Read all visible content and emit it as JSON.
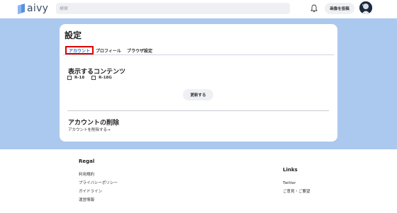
{
  "header": {
    "logo_text": "aivy",
    "search_placeholder": "検索",
    "post_button": "画像を投稿",
    "brand_color": "#5a8fe0"
  },
  "settings": {
    "title": "設定",
    "tabs": [
      {
        "label": "アカウント",
        "active": true
      },
      {
        "label": "プロフィール",
        "active": false
      },
      {
        "label": "ブラウザ設定",
        "active": false
      }
    ],
    "content_section": {
      "title": "表示するコンテンツ",
      "options": [
        {
          "label": "R-18",
          "checked": false
        },
        {
          "label": "R-18G",
          "checked": false
        }
      ],
      "update_button": "更新する"
    },
    "delete_section": {
      "title": "アカウントの削除",
      "link": "アカウントを削除する→"
    }
  },
  "footer": {
    "brand": "Regal",
    "brand_links": [
      "利用規約",
      "プライバシーポリシー",
      "ガイドライン",
      "運営情報"
    ],
    "links_title": "Links",
    "links": [
      "Twitter",
      "ご意見・ご要望"
    ]
  },
  "colors": {
    "page_background": "#abc8ee",
    "highlight": "#e00000",
    "active_tab": "#3a6fc4"
  }
}
